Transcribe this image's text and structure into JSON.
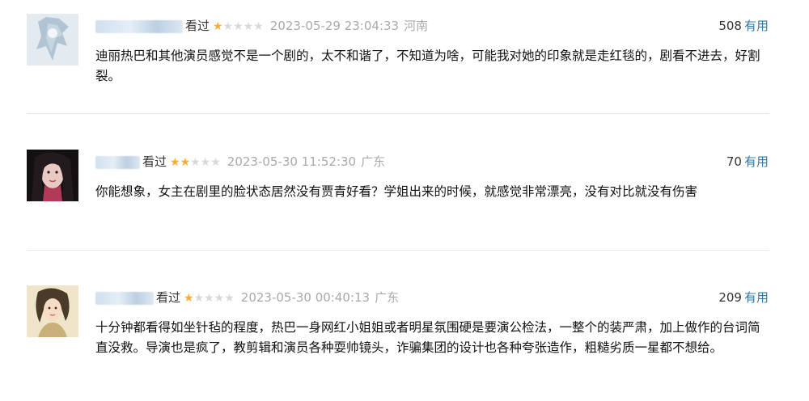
{
  "reviews": [
    {
      "watched": "看过",
      "stars": {
        "rating": 1,
        "max": 5,
        "on": "★",
        "off": "★★★★"
      },
      "time": "2023-05-29 23:04:33",
      "location": "河南",
      "votes": "508",
      "useful": "有用",
      "content": "迪丽热巴和其他演员感觉不是一个剧的，太不和谐了，不知道为啥，可能我对她的印象就是走红毯的，剧看不进去，好割裂。",
      "avatar_colors": [
        "#d9e4ec",
        "#8fa9bd"
      ]
    },
    {
      "watched": "看过",
      "stars": {
        "rating": 2,
        "max": 5,
        "on": "★★",
        "off": "★★★"
      },
      "time": "2023-05-30 11:52:30",
      "location": "广东",
      "votes": "70",
      "useful": "有用",
      "content": "你能想象，女主在剧里的脸状态居然没有贾青好看？学姐出来的时候，就感觉非常漂亮，没有对比就没有伤害",
      "avatar_colors": [
        "#1a1416",
        "#c74a6a"
      ]
    },
    {
      "watched": "看过",
      "stars": {
        "rating": 1,
        "max": 5,
        "on": "★",
        "off": "★★★★"
      },
      "time": "2023-05-30 00:40:13",
      "location": "广东",
      "votes": "209",
      "useful": "有用",
      "content": "十分钟都看得如坐针毡的程度，热巴一身网红小姐姐或者明星氛围硬是要演公检法，一整个的装严肃，加上做作的台词简直没救。导演也是疯了，教剪辑和演员各种耍帅镜头，诈骗集团的设计也各种夸张造作，粗糙劣质一星都不想给。",
      "avatar_colors": [
        "#f1e6c9",
        "#a08a5a"
      ]
    }
  ]
}
